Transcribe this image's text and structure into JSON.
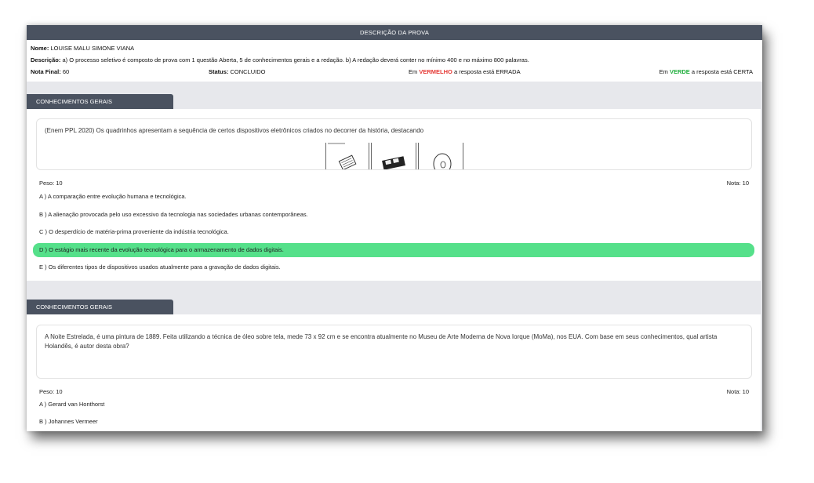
{
  "header": {
    "title": "DESCRIÇÃO DA PROVA",
    "name_label": "Nome:",
    "name_value": "LOUISE MALU SIMONE VIANA",
    "description_label": "Descrição:",
    "description_value": "a) O processo seletivo é composto de prova com 1 questão Aberta, 5 de conhecimentos gerais e a redação. b) A redação deverá conter no mínimo 400 e no máximo 800 palavras.",
    "final_grade_label": "Nota Final:",
    "final_grade_value": "60",
    "status_label": "Status:",
    "status_value": "CONCLUIDO",
    "legend_wrong": {
      "prefix": "Em",
      "keyword": "VERMELHO",
      "suffix": "a resposta está ERRADA"
    },
    "legend_right": {
      "prefix": "Em",
      "keyword": "VERDE",
      "suffix": "a resposta está CERTA"
    }
  },
  "colors": {
    "header_bg": "#4a5260",
    "wrong": "#e53935",
    "right": "#1fae3c",
    "correct_highlight": "#55e08a",
    "page_bg": "#e7e8ec"
  },
  "sections": [
    {
      "title": "CONHECIMENTOS GERAIS",
      "question": "(Enem PPL 2020) Os quadrinhos apresentam a sequência de certos dispositivos eletrônicos criados no decorrer da história, destacando",
      "peso": "Peso: 10",
      "nota": "Nota: 10",
      "options": [
        "A )  A comparação entre evolução humana e tecnológica.",
        "B ) A alienação provocada pelo uso excessivo da tecnologia nas sociedades urbanas contemporâneas.",
        "C ) O desperdício de matéria-prima proveniente da indústria tecnológica.",
        "D ) O estágio mais recente da evolução tecnológica para o armazenamento de dados digitais.",
        "E ) Os diferentes tipos de dispositivos usados atualmente para a gravação de dados digitais."
      ]
    },
    {
      "title": "CONHECIMENTOS GERAIS",
      "question": " A Noite Estrelada, é uma pintura de 1889. Feita utilizando a técnica de óleo sobre tela, mede 73 x 92 cm e se encontra atualmente no Museu de Arte Moderna de Nova Iorque (MoMa), nos EUA. Com base em seus conhecimentos, qual artista Holandês, é autor desta obra?",
      "peso": "Peso: 10",
      "nota": "Nota: 10",
      "options": [
        "A ) Gerard van Honthorst",
        "B ) Johannes Vermeer"
      ]
    }
  ]
}
